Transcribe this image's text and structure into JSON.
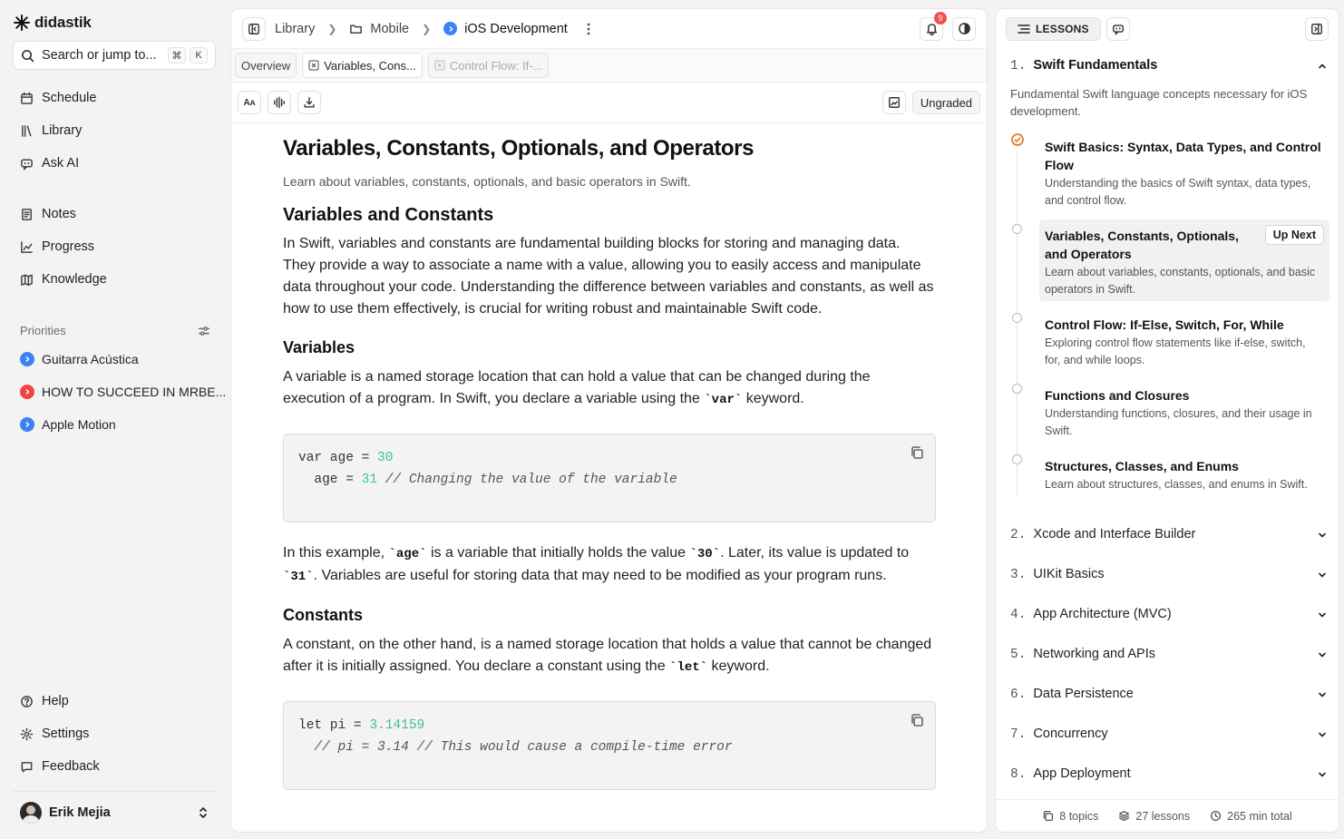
{
  "app": {
    "name": "didastik"
  },
  "sidebar": {
    "search_placeholder": "Search or jump to...",
    "shortcut": [
      "⌘",
      "K"
    ],
    "nav": [
      {
        "label": "Schedule",
        "icon": "calendar-icon"
      },
      {
        "label": "Library",
        "icon": "library-icon"
      },
      {
        "label": "Ask AI",
        "icon": "chat-bot-icon"
      },
      {
        "label": "Notes",
        "icon": "notes-icon"
      },
      {
        "label": "Progress",
        "icon": "chart-icon"
      },
      {
        "label": "Knowledge",
        "icon": "map-icon"
      }
    ],
    "priorities_label": "Priorities",
    "priorities": [
      {
        "label": "Guitarra Acústica",
        "color": "#3b82f6"
      },
      {
        "label": "HOW TO SUCCEED IN MRBE...",
        "color": "#ef4444"
      },
      {
        "label": "Apple Motion",
        "color": "#3b82f6"
      }
    ],
    "bottom": [
      {
        "label": "Help",
        "icon": "help-icon"
      },
      {
        "label": "Settings",
        "icon": "gear-icon"
      },
      {
        "label": "Feedback",
        "icon": "feedback-icon"
      }
    ],
    "user": "Erik Mejia"
  },
  "header": {
    "breadcrumbs": [
      "Library",
      "Mobile",
      "iOS Development"
    ],
    "notifications": "9"
  },
  "tabs": [
    "Overview",
    "Variables, Cons...",
    "Control Flow: If-..."
  ],
  "toolbar": {
    "grade": "Ungraded"
  },
  "lesson": {
    "title": "Variables, Constants, Optionals, and Operators",
    "subtitle": "Learn about variables, constants, optionals, and basic operators in Swift.",
    "h_var_const": "Variables and Constants",
    "p_intro": "In Swift, variables and constants are fundamental building blocks for storing and managing data. They provide a way to associate a name with a value, allowing you to easily access and manipulate data throughout your code. Understanding the difference between variables and constants, as well as how to use them effectively, is crucial for writing robust and maintainable Swift code.",
    "h_variables": "Variables",
    "p_var_1": "A variable is a named storage location that can hold a value that can be changed during the execution of a program. In Swift, you declare a variable using the ",
    "kw_var": "`var`",
    "p_var_2": " keyword.",
    "code1": {
      "l1_kw": "var age = ",
      "l1_num": "30",
      "l2_a": "  age = ",
      "l2_num": "31",
      "l2_cmt": " // Changing the value of the variable"
    },
    "p_ex_1": "In this example, ",
    "kw_age": "`age`",
    "p_ex_2": " is a variable that initially holds the value ",
    "kw_30": "`30`",
    "p_ex_3": ". Later, its value is updated to ",
    "kw_31": "`31`",
    "p_ex_4": ". Variables are useful for storing data that may need to be modified as your program runs.",
    "h_constants": "Constants",
    "p_const_1": "A constant, on the other hand, is a named storage location that holds a value that cannot be changed after it is initially assigned. You declare a constant using the ",
    "kw_let": "`let`",
    "p_const_2": " keyword.",
    "code2": {
      "l1_kw": "let pi = ",
      "l1_num": "3.14159",
      "l2_cmt": "  // pi = 3.14 // This would cause a compile-time error"
    }
  },
  "right_panel": {
    "tab_label": "LESSONS",
    "topics": [
      {
        "n": "1.",
        "title": "Swift Fundamentals"
      },
      {
        "n": "2.",
        "title": "Xcode and Interface Builder"
      },
      {
        "n": "3.",
        "title": "UIKit Basics"
      },
      {
        "n": "4.",
        "title": "App Architecture (MVC)"
      },
      {
        "n": "5.",
        "title": "Networking and APIs"
      },
      {
        "n": "6.",
        "title": "Data Persistence"
      },
      {
        "n": "7.",
        "title": "Concurrency"
      },
      {
        "n": "8.",
        "title": "App Deployment"
      }
    ],
    "topic_desc": "Fundamental Swift language concepts necessary for iOS development.",
    "lessons": [
      {
        "title": "Swift Basics: Syntax, Data Types, and Control Flow",
        "desc": "Understanding the basics of Swift syntax, data types, and control flow."
      },
      {
        "title": "Variables, Constants, Optionals, and Operators",
        "desc": "Learn about variables, constants, optionals, and basic operators in Swift."
      },
      {
        "title": "Control Flow: If-Else, Switch, For, While",
        "desc": "Exploring control flow statements like if-else, switch, for, and while loops."
      },
      {
        "title": "Functions and Closures",
        "desc": "Understanding functions, closures, and their usage in Swift."
      },
      {
        "title": "Structures, Classes, and Enums",
        "desc": "Learn about structures, classes, and enums in Swift."
      }
    ],
    "up_next": "Up Next",
    "footer": {
      "topics": "8 topics",
      "lessons": "27 lessons",
      "total": "265 min total"
    }
  }
}
